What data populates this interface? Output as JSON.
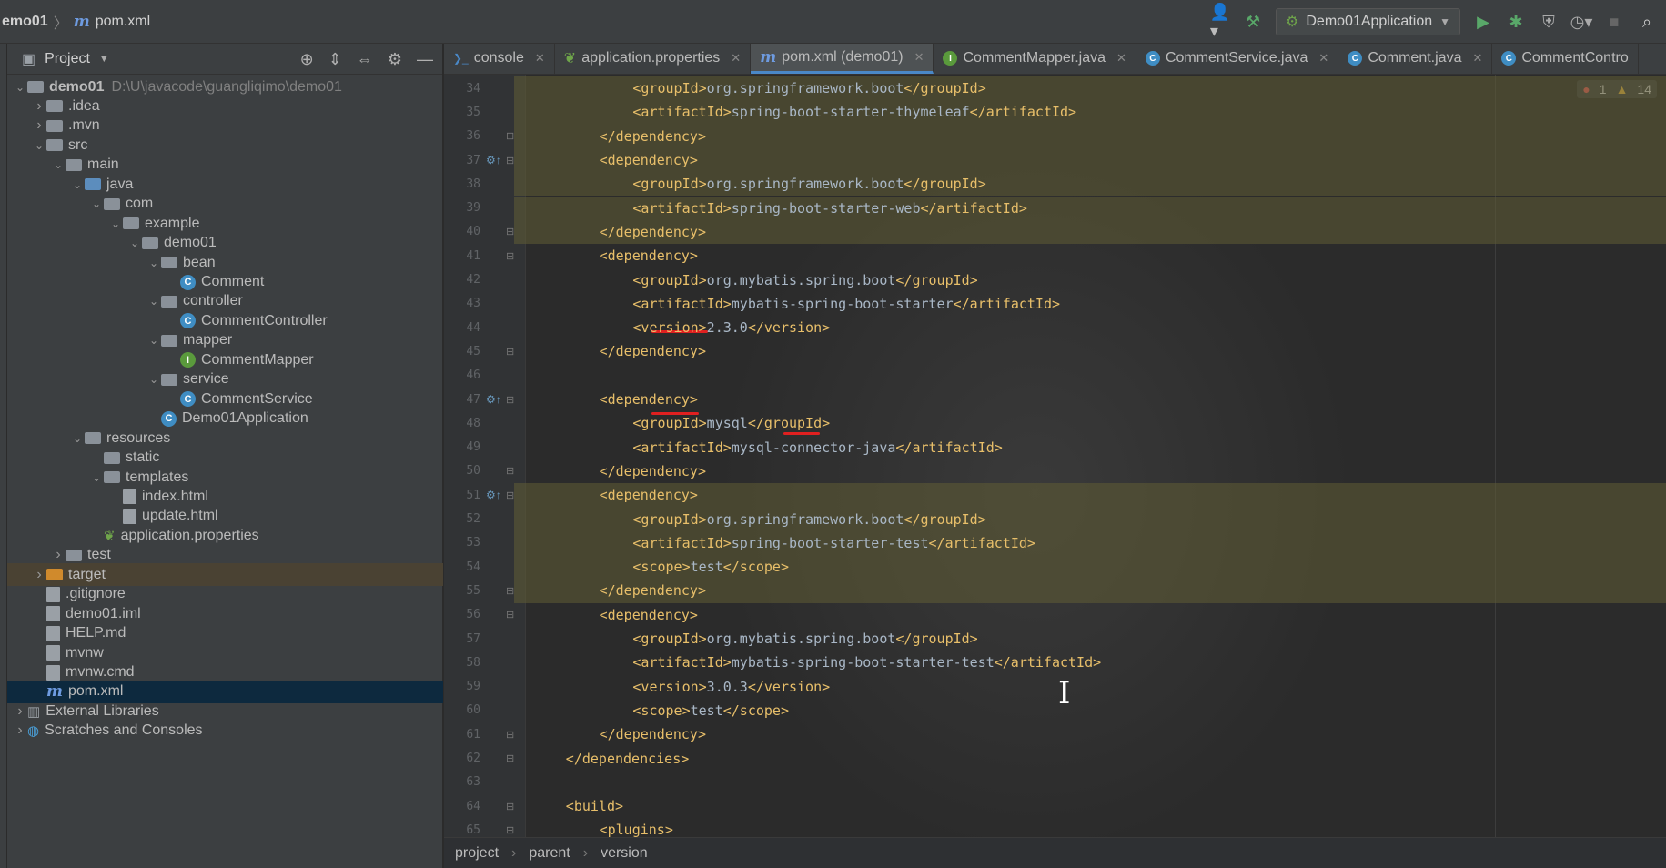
{
  "breadcrumb": {
    "project": "emo01",
    "file": "pom.xml"
  },
  "toolbar": {
    "run_config": "Demo01Application"
  },
  "project_panel": {
    "title": "Project",
    "items": [
      {
        "label": "demo01",
        "path": "D:\\U\\javacode\\guangliqimo\\demo01",
        "depth": 0,
        "icon": "folder",
        "expanded": true
      },
      {
        "label": ".idea",
        "depth": 1,
        "icon": "folder",
        "collapsed": true
      },
      {
        "label": ".mvn",
        "depth": 1,
        "icon": "folder",
        "collapsed": true
      },
      {
        "label": "src",
        "depth": 1,
        "icon": "folder",
        "expanded": true
      },
      {
        "label": "main",
        "depth": 2,
        "icon": "folder",
        "expanded": true
      },
      {
        "label": "java",
        "depth": 3,
        "icon": "folder-src",
        "expanded": true
      },
      {
        "label": "com",
        "depth": 4,
        "icon": "package",
        "expanded": true
      },
      {
        "label": "example",
        "depth": 5,
        "icon": "package",
        "expanded": true
      },
      {
        "label": "demo01",
        "depth": 6,
        "icon": "package",
        "expanded": true
      },
      {
        "label": "bean",
        "depth": 7,
        "icon": "package",
        "expanded": true
      },
      {
        "label": "Comment",
        "depth": 8,
        "icon": "class"
      },
      {
        "label": "controller",
        "depth": 7,
        "icon": "package",
        "expanded": true
      },
      {
        "label": "CommentController",
        "depth": 8,
        "icon": "class"
      },
      {
        "label": "mapper",
        "depth": 7,
        "icon": "package",
        "expanded": true
      },
      {
        "label": "CommentMapper",
        "depth": 8,
        "icon": "interface"
      },
      {
        "label": "service",
        "depth": 7,
        "icon": "package",
        "expanded": true
      },
      {
        "label": "CommentService",
        "depth": 8,
        "icon": "class"
      },
      {
        "label": "Demo01Application",
        "depth": 7,
        "icon": "spring-class"
      },
      {
        "label": "resources",
        "depth": 3,
        "icon": "folder-res",
        "expanded": true
      },
      {
        "label": "static",
        "depth": 4,
        "icon": "folder"
      },
      {
        "label": "templates",
        "depth": 4,
        "icon": "folder",
        "expanded": true
      },
      {
        "label": "index.html",
        "depth": 5,
        "icon": "html"
      },
      {
        "label": "update.html",
        "depth": 5,
        "icon": "html"
      },
      {
        "label": "application.properties",
        "depth": 4,
        "icon": "leaf"
      },
      {
        "label": "test",
        "depth": 2,
        "icon": "folder",
        "collapsed": true
      },
      {
        "label": "target",
        "depth": 1,
        "icon": "folder-orange",
        "collapsed": true,
        "excluded": true
      },
      {
        "label": ".gitignore",
        "depth": 1,
        "icon": "file"
      },
      {
        "label": "demo01.iml",
        "depth": 1,
        "icon": "file"
      },
      {
        "label": "HELP.md",
        "depth": 1,
        "icon": "md"
      },
      {
        "label": "mvnw",
        "depth": 1,
        "icon": "file"
      },
      {
        "label": "mvnw.cmd",
        "depth": 1,
        "icon": "file"
      },
      {
        "label": "pom.xml",
        "depth": 1,
        "icon": "maven",
        "selected": true
      },
      {
        "label": "External Libraries",
        "depth": 0,
        "icon": "libs",
        "collapsed": true
      },
      {
        "label": "Scratches and Consoles",
        "depth": 0,
        "icon": "scratch",
        "collapsed": true
      }
    ]
  },
  "tabs": [
    {
      "label": "console",
      "icon": "console",
      "active": false
    },
    {
      "label": "application.properties",
      "icon": "leaf",
      "active": false
    },
    {
      "label": "pom.xml (demo01)",
      "icon": "maven",
      "active": true
    },
    {
      "label": "CommentMapper.java",
      "icon": "interface",
      "active": false
    },
    {
      "label": "CommentService.java",
      "icon": "class",
      "active": false
    },
    {
      "label": "Comment.java",
      "icon": "class",
      "active": false
    },
    {
      "label": "CommentContro",
      "icon": "class",
      "active": false
    }
  ],
  "inspections": {
    "errors": "1",
    "warnings": "14"
  },
  "code_lines": [
    {
      "num": "34",
      "indent": 3,
      "parts": [
        [
          "tag",
          "<groupId>"
        ],
        [
          "val",
          "org.springframework.boot"
        ],
        [
          "tag",
          "</groupId>"
        ]
      ],
      "hl": true
    },
    {
      "num": "35",
      "indent": 3,
      "parts": [
        [
          "tag",
          "<artifactId>"
        ],
        [
          "val",
          "spring-boot-starter-thymeleaf"
        ],
        [
          "tag",
          "</artifactId>"
        ]
      ],
      "hl": true
    },
    {
      "num": "36",
      "indent": 2,
      "parts": [
        [
          "tag",
          "</dependency>"
        ]
      ],
      "hl": true,
      "fold": true
    },
    {
      "num": "37",
      "indent": 2,
      "parts": [
        [
          "tag",
          "<dependency>"
        ]
      ],
      "hl": true,
      "fold": true,
      "gmark": true
    },
    {
      "num": "38",
      "indent": 3,
      "parts": [
        [
          "tag",
          "<groupId>"
        ],
        [
          "val",
          "org.springframework.boot"
        ],
        [
          "tag",
          "</groupId>"
        ]
      ],
      "hl": true
    },
    {
      "num": "39",
      "indent": 3,
      "parts": [
        [
          "tag",
          "<artifactId>"
        ],
        [
          "val",
          "spring-boot-starter-web"
        ],
        [
          "tag",
          "</artifactId>"
        ]
      ],
      "hl": true
    },
    {
      "num": "40",
      "indent": 2,
      "parts": [
        [
          "tag",
          "</dependency>"
        ]
      ],
      "hl": true,
      "fold": true
    },
    {
      "num": "41",
      "indent": 2,
      "parts": [
        [
          "tag",
          "<dependency>"
        ]
      ],
      "fold": true
    },
    {
      "num": "42",
      "indent": 3,
      "parts": [
        [
          "tag",
          "<groupId>"
        ],
        [
          "val",
          "org.mybatis.spring.boot"
        ],
        [
          "tag",
          "</groupId>"
        ]
      ]
    },
    {
      "num": "43",
      "indent": 3,
      "parts": [
        [
          "tag",
          "<artifactId>"
        ],
        [
          "val",
          "mybatis-spring-boot-starter"
        ],
        [
          "tag",
          "</artifactId>"
        ]
      ]
    },
    {
      "num": "44",
      "indent": 3,
      "parts": [
        [
          "tag",
          "<version>"
        ],
        [
          "val",
          "2.3.0"
        ],
        [
          "tag",
          "</version>"
        ]
      ]
    },
    {
      "num": "45",
      "indent": 2,
      "parts": [
        [
          "tag",
          "</dependency>"
        ]
      ],
      "fold": true
    },
    {
      "num": "46",
      "indent": 0,
      "parts": []
    },
    {
      "num": "47",
      "indent": 2,
      "parts": [
        [
          "tag",
          "<dependency>"
        ]
      ],
      "fold": true,
      "gmark": true
    },
    {
      "num": "48",
      "indent": 3,
      "parts": [
        [
          "tag",
          "<groupId>"
        ],
        [
          "val",
          "mysql"
        ],
        [
          "tag",
          "</groupId>"
        ]
      ]
    },
    {
      "num": "49",
      "indent": 3,
      "parts": [
        [
          "tag",
          "<artifactId>"
        ],
        [
          "val",
          "mysql-connector-java"
        ],
        [
          "tag",
          "</artifactId>"
        ]
      ]
    },
    {
      "num": "50",
      "indent": 2,
      "parts": [
        [
          "tag",
          "</dependency>"
        ]
      ],
      "fold": true
    },
    {
      "num": "51",
      "indent": 2,
      "parts": [
        [
          "tag",
          "<dependency>"
        ]
      ],
      "hl": true,
      "fold": true,
      "gmark": true
    },
    {
      "num": "52",
      "indent": 3,
      "parts": [
        [
          "tag",
          "<groupId>"
        ],
        [
          "val",
          "org.springframework.boot"
        ],
        [
          "tag",
          "</groupId>"
        ]
      ],
      "hl": true
    },
    {
      "num": "53",
      "indent": 3,
      "parts": [
        [
          "tag",
          "<artifactId>"
        ],
        [
          "val",
          "spring-boot-starter-test"
        ],
        [
          "tag",
          "</artifactId>"
        ]
      ],
      "hl": true
    },
    {
      "num": "54",
      "indent": 3,
      "parts": [
        [
          "tag",
          "<scope>"
        ],
        [
          "val",
          "test"
        ],
        [
          "tag",
          "</scope>"
        ]
      ],
      "hl": true
    },
    {
      "num": "55",
      "indent": 2,
      "parts": [
        [
          "tag",
          "</dependency>"
        ]
      ],
      "hl": true,
      "fold": true
    },
    {
      "num": "56",
      "indent": 2,
      "parts": [
        [
          "tag",
          "<dependency>"
        ]
      ],
      "fold": true
    },
    {
      "num": "57",
      "indent": 3,
      "parts": [
        [
          "tag",
          "<groupId>"
        ],
        [
          "val",
          "org.mybatis.spring.boot"
        ],
        [
          "tag",
          "</groupId>"
        ]
      ]
    },
    {
      "num": "58",
      "indent": 3,
      "parts": [
        [
          "tag",
          "<artifactId>"
        ],
        [
          "val",
          "mybatis-spring-boot-starter-test"
        ],
        [
          "tag",
          "</artifactId>"
        ]
      ]
    },
    {
      "num": "59",
      "indent": 3,
      "parts": [
        [
          "tag",
          "<version>"
        ],
        [
          "val",
          "3.0.3"
        ],
        [
          "tag",
          "</version>"
        ]
      ]
    },
    {
      "num": "60",
      "indent": 3,
      "parts": [
        [
          "tag",
          "<scope>"
        ],
        [
          "val",
          "test"
        ],
        [
          "tag",
          "</scope>"
        ]
      ]
    },
    {
      "num": "61",
      "indent": 2,
      "parts": [
        [
          "tag",
          "</dependency>"
        ]
      ],
      "fold": true
    },
    {
      "num": "62",
      "indent": 1,
      "parts": [
        [
          "tag",
          "</dependencies>"
        ]
      ],
      "fold": true
    },
    {
      "num": "63",
      "indent": 0,
      "parts": []
    },
    {
      "num": "64",
      "indent": 1,
      "parts": [
        [
          "tag",
          "<build>"
        ]
      ],
      "fold": true
    },
    {
      "num": "65",
      "indent": 2,
      "parts": [
        [
          "tag",
          "<plugins>"
        ]
      ],
      "fold": true
    }
  ],
  "status_breadcrumb": [
    "project",
    "parent",
    "version"
  ]
}
